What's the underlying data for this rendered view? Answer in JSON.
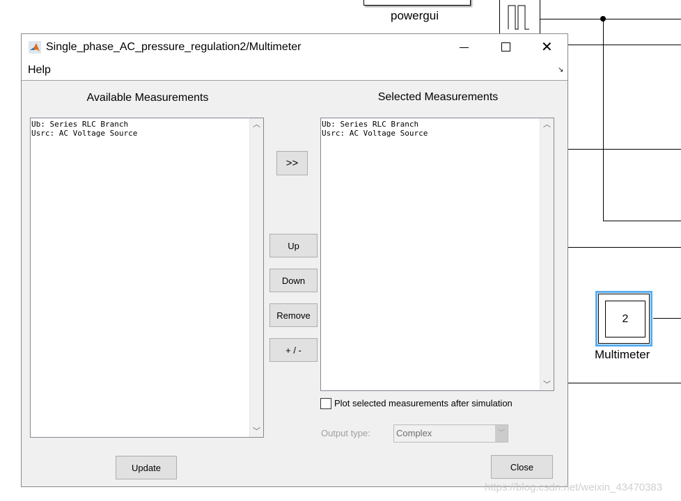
{
  "background": {
    "powergui_label": "powergui",
    "multimeter_label": "Multimeter",
    "multimeter_value": "2",
    "highlight_color": "#5aaef0"
  },
  "dialog": {
    "title": "Single_phase_AC_pressure_regulation2/Multimeter",
    "menu": {
      "help": "Help"
    },
    "available": {
      "heading": "Available Measurements",
      "items": [
        "Ub: Series RLC Branch",
        "Usrc: AC Voltage Source"
      ]
    },
    "selected": {
      "heading": "Selected Measurements",
      "items": [
        "Ub: Series RLC Branch",
        "Usrc: AC Voltage Source"
      ]
    },
    "buttons": {
      "add": ">>",
      "up": "Up",
      "down": "Down",
      "remove": "Remove",
      "plusminus": "+ / -",
      "update": "Update",
      "close": "Close"
    },
    "plot_checkbox": {
      "label": "Plot selected measurements after simulation",
      "checked": false
    },
    "output_type": {
      "label": "Output type:",
      "value": "Complex",
      "enabled": false
    }
  },
  "watermark": "https://blog.csdn.net/weixin_43470383"
}
